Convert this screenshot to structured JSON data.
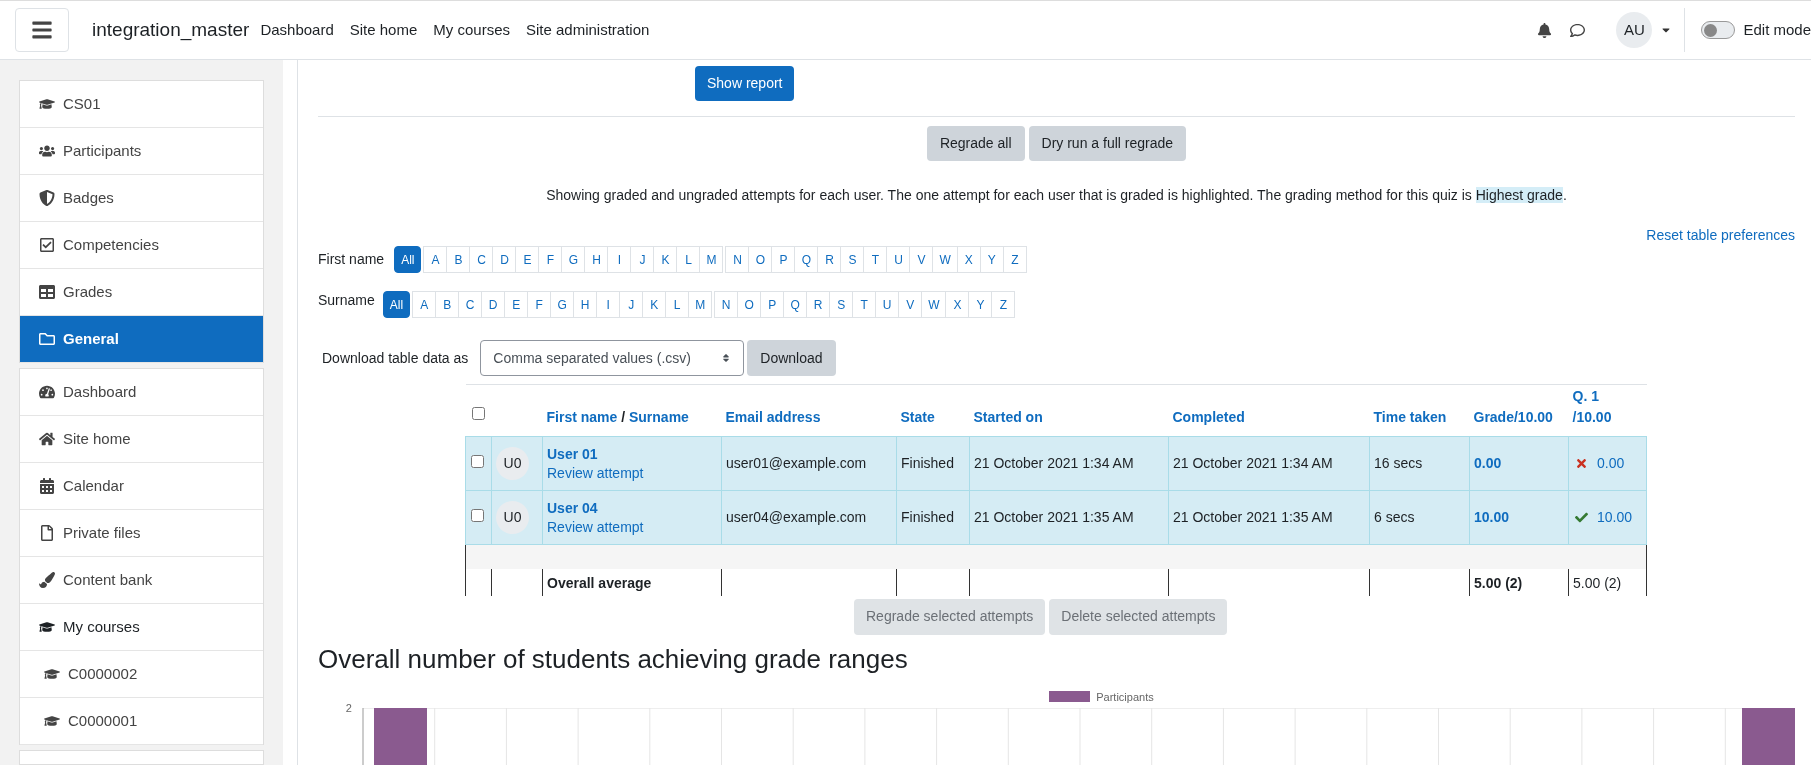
{
  "topbar": {
    "site_name": "integration_master",
    "nav": [
      "Dashboard",
      "Site home",
      "My courses",
      "Site administration"
    ],
    "avatar": "AU",
    "edit_mode": {
      "label": "Edit mode",
      "on": false
    }
  },
  "sidebar": {
    "sections": [
      {
        "items": [
          {
            "label": "CS01",
            "selected": false
          },
          {
            "label": "Participants",
            "selected": false
          },
          {
            "label": "Badges",
            "selected": false
          },
          {
            "label": "Competencies",
            "selected": false
          },
          {
            "label": "Grades",
            "selected": false
          },
          {
            "label": "General",
            "selected": true
          }
        ]
      },
      {
        "items": [
          {
            "label": "Dashboard",
            "selected": false
          },
          {
            "label": "Site home",
            "selected": false
          },
          {
            "label": "Calendar",
            "selected": false
          },
          {
            "label": "Private files",
            "selected": false
          },
          {
            "label": "Content bank",
            "selected": false
          },
          {
            "label": "My courses",
            "selected": false,
            "children": [
              {
                "label": "C0000002",
                "selected": false
              },
              {
                "label": "C0000001",
                "selected": false
              }
            ]
          }
        ]
      }
    ]
  },
  "show_report": "Show report",
  "regrade_buttons": [
    "Regrade all",
    "Dry run a full regrade"
  ],
  "info": {
    "text": "Showing graded and ungraded attempts for each user. The one attempt for each user that is graded is highlighted. The grading method for this quiz is ",
    "highlight": "Highest grade",
    "end": "."
  },
  "reset_link": "Reset table preferences",
  "initials_bars": [
    {
      "label": "First name",
      "groups": [
        [
          {
            "label": "All",
            "selected": true
          }
        ],
        [
          {
            "label": "A",
            "selected": false
          },
          {
            "label": "B",
            "selected": false
          },
          {
            "label": "C",
            "selected": false
          },
          {
            "label": "D",
            "selected": false
          },
          {
            "label": "E",
            "selected": false
          },
          {
            "label": "F",
            "selected": false
          },
          {
            "label": "G",
            "selected": false
          },
          {
            "label": "H",
            "selected": false
          },
          {
            "label": "I",
            "selected": false
          },
          {
            "label": "J",
            "selected": false
          },
          {
            "label": "K",
            "selected": false
          },
          {
            "label": "L",
            "selected": false
          },
          {
            "label": "M",
            "selected": false
          }
        ],
        [
          {
            "label": "N",
            "selected": false
          },
          {
            "label": "O",
            "selected": false
          },
          {
            "label": "P",
            "selected": false
          },
          {
            "label": "Q",
            "selected": false
          },
          {
            "label": "R",
            "selected": false
          },
          {
            "label": "S",
            "selected": false
          },
          {
            "label": "T",
            "selected": false
          },
          {
            "label": "U",
            "selected": false
          },
          {
            "label": "V",
            "selected": false
          },
          {
            "label": "W",
            "selected": false
          },
          {
            "label": "X",
            "selected": false
          },
          {
            "label": "Y",
            "selected": false
          },
          {
            "label": "Z",
            "selected": false
          }
        ]
      ]
    },
    {
      "label": "Surname",
      "groups": [
        [
          {
            "label": "All",
            "selected": true
          }
        ],
        [
          {
            "label": "A",
            "selected": false
          },
          {
            "label": "B",
            "selected": false
          },
          {
            "label": "C",
            "selected": false
          },
          {
            "label": "D",
            "selected": false
          },
          {
            "label": "E",
            "selected": false
          },
          {
            "label": "F",
            "selected": false
          },
          {
            "label": "G",
            "selected": false
          },
          {
            "label": "H",
            "selected": false
          },
          {
            "label": "I",
            "selected": false
          },
          {
            "label": "J",
            "selected": false
          },
          {
            "label": "K",
            "selected": false
          },
          {
            "label": "L",
            "selected": false
          },
          {
            "label": "M",
            "selected": false
          }
        ],
        [
          {
            "label": "N",
            "selected": false
          },
          {
            "label": "O",
            "selected": false
          },
          {
            "label": "P",
            "selected": false
          },
          {
            "label": "Q",
            "selected": false
          },
          {
            "label": "R",
            "selected": false
          },
          {
            "label": "S",
            "selected": false
          },
          {
            "label": "T",
            "selected": false
          },
          {
            "label": "U",
            "selected": false
          },
          {
            "label": "V",
            "selected": false
          },
          {
            "label": "W",
            "selected": false
          },
          {
            "label": "X",
            "selected": false
          },
          {
            "label": "Y",
            "selected": false
          },
          {
            "label": "Z",
            "selected": false
          }
        ]
      ]
    }
  ],
  "download": {
    "label": "Download table data as",
    "format": "Comma separated values (.csv)",
    "button": "Download"
  },
  "table": {
    "select_all_checked": false,
    "header": {
      "first_name": "First name",
      "separator": "/",
      "surname": "Surname",
      "columns": [
        "Email address",
        "State",
        "Started on",
        "Completed",
        "Time taken",
        "Grade/10.00",
        "Q. 1 /10.00"
      ]
    },
    "rows": [
      {
        "checked": false,
        "highlighted": true,
        "avatar": "U0",
        "name": "User 01",
        "review": "Review attempt",
        "email": "user01@example.com",
        "state": "Finished",
        "started": "21 October 2021 1:34 AM",
        "completed": "21 October 2021 1:34 AM",
        "time": "16 secs",
        "grade": "0.00",
        "q1": "0.00",
        "correct": false
      },
      {
        "checked": false,
        "highlighted": true,
        "avatar": "U0",
        "name": "User 04",
        "review": "Review attempt",
        "email": "user04@example.com",
        "state": "Finished",
        "started": "21 October 2021 1:35 AM",
        "completed": "21 October 2021 1:35 AM",
        "time": "6 secs",
        "grade": "10.00",
        "q1": "10.00",
        "correct": true
      }
    ],
    "average": {
      "label": "Overall average",
      "grade": "5.00 (2)",
      "q1": "5.00 (2)"
    }
  },
  "bulk_buttons": [
    {
      "label": "Regrade selected attempts",
      "disabled": true
    },
    {
      "label": "Delete selected attempts",
      "disabled": true
    }
  ],
  "chart": {
    "title": "Overall number of students achieving grade ranges",
    "legend": "Participants",
    "y_tick": "2"
  }
}
